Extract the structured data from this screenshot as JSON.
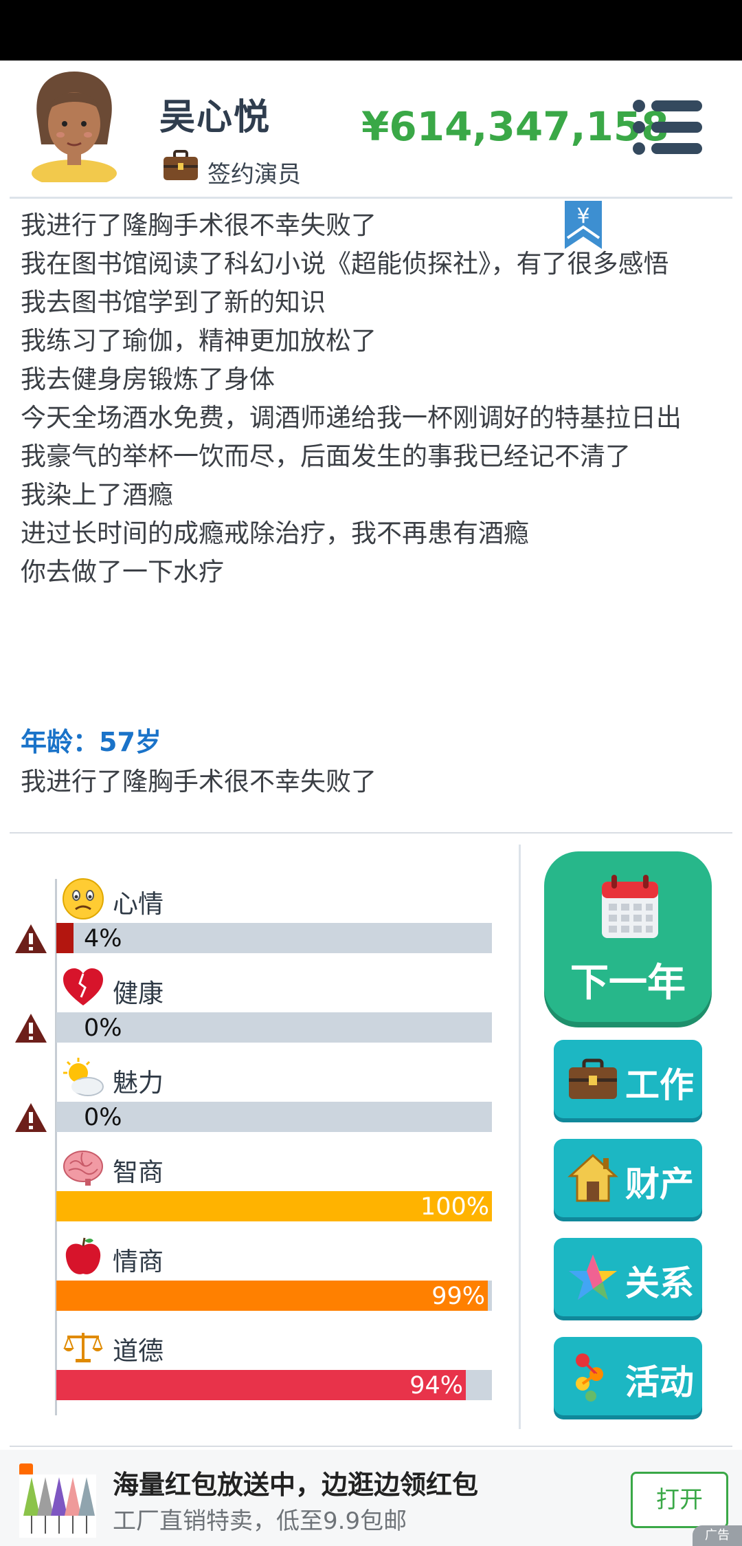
{
  "header": {
    "name": "吴心悦",
    "job": "签约演员",
    "money": "¥614,347,158",
    "bookmark_symbol": "¥"
  },
  "log": [
    "我进行了隆胸手术很不幸失败了",
    "我在图书馆阅读了科幻小说《超能侦探社》，有了很多感悟",
    "我去图书馆学到了新的知识",
    "我练习了瑜伽，精神更加放松了",
    "我去健身房锻炼了身体",
    "今天全场酒水免费，调酒师递给我一杯刚调好的特基拉日出",
    "我豪气的举杯一饮而尽，后面发生的事我已经记不清了",
    "我染上了酒瘾",
    "进过长时间的成瘾戒除治疗，我不再患有酒瘾",
    "你去做了一下水疗"
  ],
  "age_label": "年龄：57岁",
  "age_event": "我进行了隆胸手术很不幸失败了",
  "stats": [
    {
      "label": "心情",
      "value_text": "4%",
      "level": 0.04,
      "color": "#b3160f",
      "icon": "sad-face-icon",
      "warning": true
    },
    {
      "label": "健康",
      "value_text": "0%",
      "level": 0.0,
      "color": "#b3160f",
      "icon": "broken-heart-icon",
      "warning": true
    },
    {
      "label": "魅力",
      "value_text": "0%",
      "level": 0.0,
      "color": "#b3160f",
      "icon": "sun-cloud-icon",
      "warning": true
    },
    {
      "label": "智商",
      "value_text": "100%",
      "level": 1.0,
      "color": "#ffb300",
      "icon": "brain-icon",
      "warning": false
    },
    {
      "label": "情商",
      "value_text": "99%",
      "level": 0.99,
      "color": "#ff8000",
      "icon": "apple-icon",
      "warning": false
    },
    {
      "label": "道德",
      "value_text": "94%",
      "level": 0.94,
      "color": "#e8334a",
      "icon": "scales-icon",
      "warning": false
    }
  ],
  "buttons": {
    "next_year": "下一年",
    "work": "工作",
    "property": "财产",
    "relations": "关系",
    "activities": "活动"
  },
  "ad": {
    "title": "海量红包放送中，边逛边领红包",
    "subtitle": "工厂直销特卖，低至9.9包邮",
    "open": "打开",
    "tag": "广告"
  },
  "colors": {
    "money": "#3aa847",
    "age": "#1a73c9",
    "next_year_button": "#27b78a",
    "action_button": "#1cb7c3"
  }
}
